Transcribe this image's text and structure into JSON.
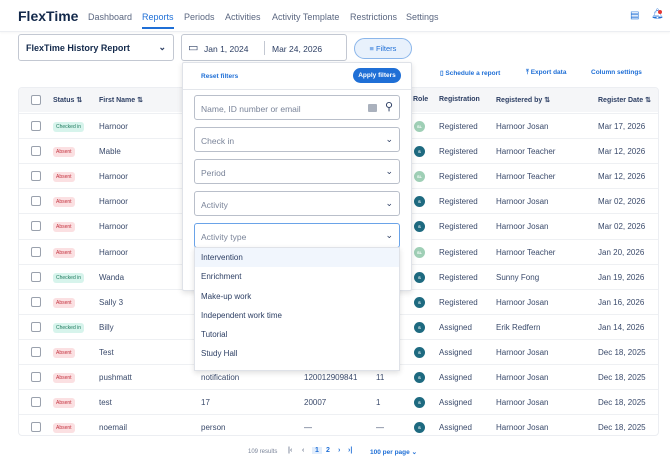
{
  "nav": {
    "logo": "FlexTime",
    "items": [
      "Dashboard",
      "Reports",
      "Periods",
      "Activities",
      "Activity Template",
      "Restrictions",
      "Settings"
    ],
    "active": 1
  },
  "toolbar": {
    "report": "FlexTime History Report",
    "date_from": "Jan 1, 2024",
    "date_to": "Mar 24, 2026",
    "filters": "Filters",
    "schedule": "Schedule a report",
    "export": "Export data",
    "columns": "Column settings"
  },
  "filters_panel": {
    "reset": "Reset filters",
    "apply": "Apply filters",
    "search_placeholder": "Name, ID number or email",
    "check_in": "Check in",
    "period": "Period",
    "activity": "Activity",
    "activity_type": "Activity type",
    "options": [
      "Intervention",
      "Enrichment",
      "Make-up work",
      "Independent work time",
      "Tutorial",
      "Study Hall"
    ]
  },
  "table": {
    "headers": {
      "status": "Status",
      "first": "First Name",
      "role": "Role",
      "registration": "Registration",
      "registered_by": "Registered by",
      "date": "Register Date"
    },
    "rows": [
      {
        "status": "Checked in",
        "first": "Harnoor",
        "last": "",
        "id": "",
        "grade": "",
        "role": "SL",
        "reg": "Registered",
        "by": "Harnoor Josan",
        "date": "Mar 17, 2026"
      },
      {
        "status": "Absent",
        "first": "Mable",
        "last": "",
        "id": "",
        "grade": "",
        "role": "S",
        "reg": "Registered",
        "by": "Harnoor Teacher",
        "date": "Mar 12, 2026"
      },
      {
        "status": "Absent",
        "first": "Harnoor",
        "last": "",
        "id": "",
        "grade": "",
        "role": "SL",
        "reg": "Registered",
        "by": "Harnoor Teacher",
        "date": "Mar 12, 2026"
      },
      {
        "status": "Absent",
        "first": "Harnoor",
        "last": "",
        "id": "",
        "grade": "",
        "role": "S",
        "reg": "Registered",
        "by": "Harnoor Josan",
        "date": "Mar 02, 2026"
      },
      {
        "status": "Absent",
        "first": "Harnoor",
        "last": "",
        "id": "",
        "grade": "",
        "role": "S",
        "reg": "Registered",
        "by": "Harnoor Josan",
        "date": "Mar 02, 2026"
      },
      {
        "status": "Absent",
        "first": "Harnoor",
        "last": "",
        "id": "",
        "grade": "",
        "role": "SL",
        "reg": "Registered",
        "by": "Harnoor Teacher",
        "date": "Jan 20, 2026"
      },
      {
        "status": "Checked in",
        "first": "Wanda",
        "last": "",
        "id": "",
        "grade": "",
        "role": "S",
        "reg": "Registered",
        "by": "Sunny Fong",
        "date": "Jan 19, 2026"
      },
      {
        "status": "Absent",
        "first": "Sally 3",
        "last": "",
        "id": "",
        "grade": "",
        "role": "S",
        "reg": "Registered",
        "by": "Harnoor Josan",
        "date": "Jan 16, 2026"
      },
      {
        "status": "Checked in",
        "first": "Billy",
        "last": "",
        "id": "",
        "grade": "",
        "role": "S",
        "reg": "Assigned",
        "by": "Erik Redfern",
        "date": "Jan 14, 2026"
      },
      {
        "status": "Absent",
        "first": "Test",
        "last": "",
        "id": "",
        "grade": "",
        "role": "S",
        "reg": "Assigned",
        "by": "Harnoor Josan",
        "date": "Dec 18, 2025"
      },
      {
        "status": "Absent",
        "first": "pushmatt",
        "last": "notification",
        "id": "120012909841",
        "grade": "11",
        "role": "S",
        "reg": "Assigned",
        "by": "Harnoor Josan",
        "date": "Dec 18, 2025"
      },
      {
        "status": "Absent",
        "first": "test",
        "last": "17",
        "id": "20007",
        "grade": "1",
        "role": "S",
        "reg": "Assigned",
        "by": "Harnoor Josan",
        "date": "Dec 18, 2025"
      },
      {
        "status": "Absent",
        "first": "noemail",
        "last": "person",
        "id": "—",
        "grade": "—",
        "role": "S",
        "reg": "Assigned",
        "by": "Harnoor Josan",
        "date": "Dec 18, 2025"
      }
    ]
  },
  "pagination": {
    "results": "109 results",
    "pages": [
      "1",
      "2"
    ],
    "current": "1",
    "per_page": "100 per page"
  },
  "colors": {
    "accent": "#1f6fd6",
    "role_s": "#1e6a80",
    "role_sl": "#9fcfb6"
  }
}
